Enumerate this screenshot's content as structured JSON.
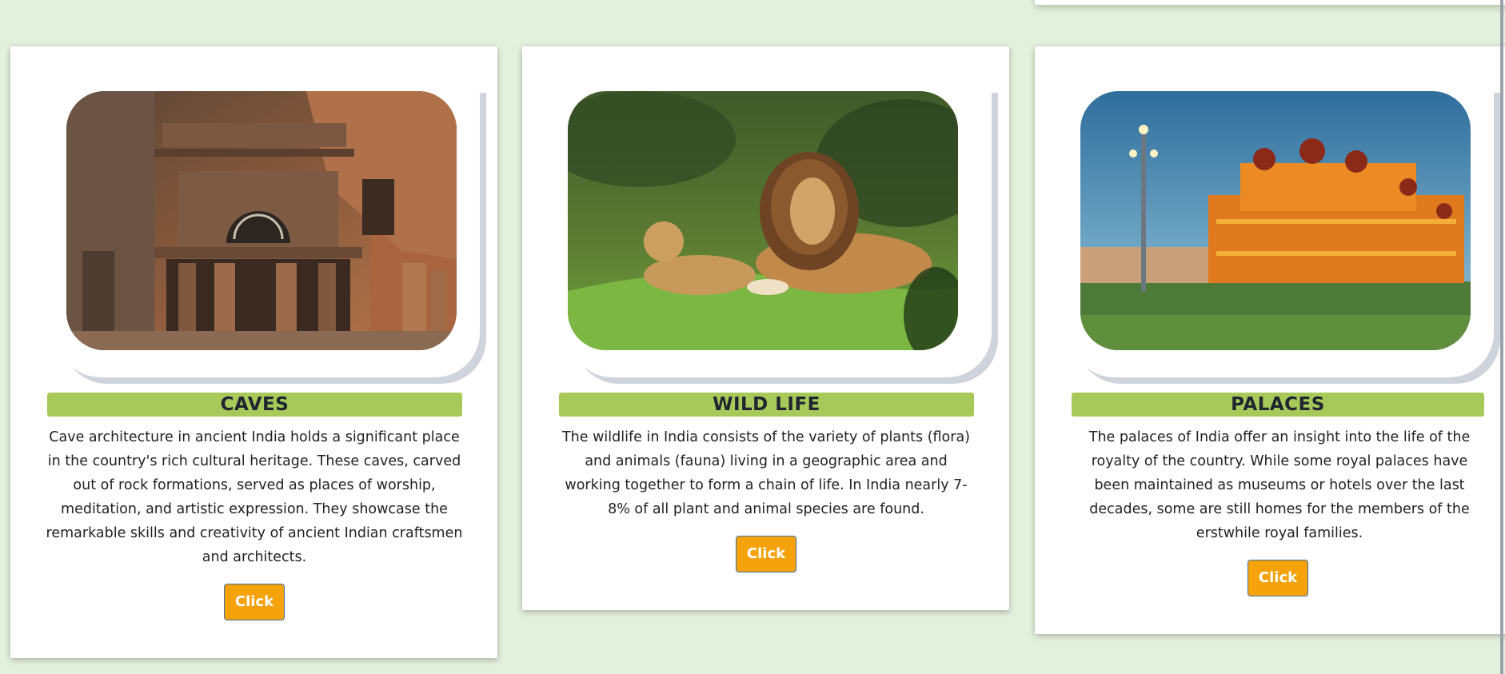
{
  "cards": [
    {
      "title": "CAVES",
      "image_alt": "caves-photo",
      "description": "Cave architecture in ancient India holds a significant place in the country's rich cultural heritage. These caves, carved out of rock formations, served as places of worship, meditation, and artistic expression. They showcase the remarkable skills and creativity of ancient Indian craftsmen and architects.",
      "button_label": "Click"
    },
    {
      "title": "WILD LIFE",
      "image_alt": "wildlife-photo",
      "description": "The wildlife in India consists of the variety of plants (flora) and animals (fauna) living in a geographic area and working together to form a chain of life. In India nearly 7-8% of all plant and animal species are found.",
      "button_label": "Click"
    },
    {
      "title": "PALACES",
      "image_alt": "palace-photo",
      "description": "The palaces of India offer an insight into the life of the royalty of the country. While some royal palaces have been maintained as museums or hotels over the last decades, some are still homes for the members of the erstwhile royal families.",
      "button_label": "Click"
    }
  ],
  "colors": {
    "page_background": "#e3f0dc",
    "title_bar": "#a6c95a",
    "button": "#f6a20b",
    "button_border": "#3c6fa8"
  }
}
